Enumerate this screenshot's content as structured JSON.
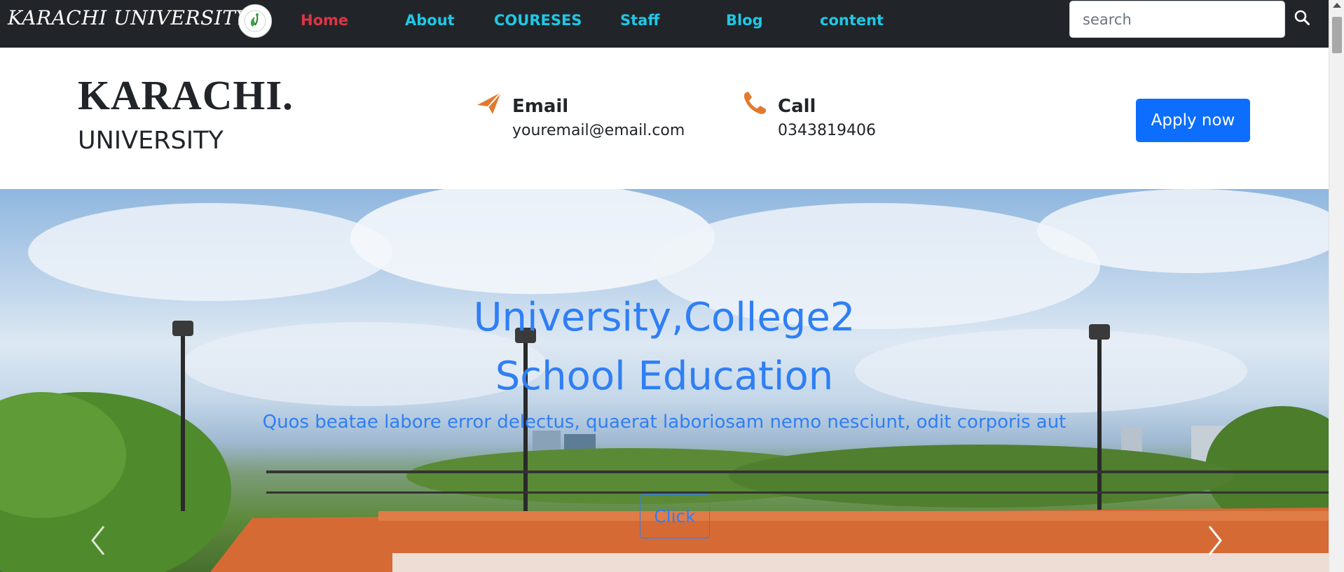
{
  "navbar": {
    "brand": "KARACHI UNIVERSITY",
    "links": [
      {
        "label": "Home",
        "active": true
      },
      {
        "label": "About",
        "active": false
      },
      {
        "label": "COURESES",
        "active": false
      },
      {
        "label": "Staff",
        "active": false
      },
      {
        "label": "Blog",
        "active": false
      },
      {
        "label": "content",
        "active": false
      }
    ],
    "search_placeholder": "search",
    "search_icon": "search-icon"
  },
  "header": {
    "title": "KARACHI.",
    "subtitle": "UNIVERSITY",
    "email": {
      "label": "Email",
      "value": "youremail@email.com",
      "icon": "paper-plane-icon"
    },
    "call": {
      "label": "Call",
      "value": "0343819406",
      "icon": "phone-icon"
    },
    "apply_label": "Apply now"
  },
  "hero": {
    "heading_line1": "University,College2",
    "heading_line2": "School Education",
    "paragraph": "Quos beatae labore error delectus, quaerat laboriosam nemo nesciunt, odit corporis aut",
    "button_label": "Click",
    "prev_icon": "chevron-left-icon",
    "next_icon": "chevron-right-icon"
  },
  "colors": {
    "navbar_bg": "#212529",
    "nav_link": "#1ec8e6",
    "nav_active": "#dc3545",
    "primary": "#0d6efd",
    "hero_text": "#2f7ff5",
    "accent_orange": "#e07a2e"
  }
}
